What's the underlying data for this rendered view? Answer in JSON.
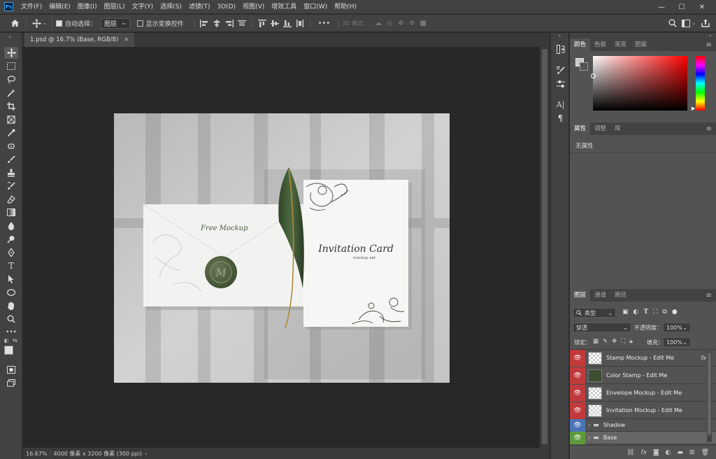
{
  "menubar": {
    "logo": "Ps",
    "items": [
      "文件(F)",
      "编辑(E)",
      "图像(I)",
      "图层(L)",
      "文字(Y)",
      "选择(S)",
      "滤镜(T)",
      "3D(D)",
      "视图(V)",
      "增效工具",
      "窗口(W)",
      "帮助(H)"
    ],
    "minimize": "—",
    "maximize": "☐",
    "close": "✕"
  },
  "options": {
    "auto_select_label": "自动选择：",
    "auto_select_value": "图层",
    "show_transform_label": "显示变换控件",
    "mode_3d_label": "3D 模式：",
    "more": "•••"
  },
  "document": {
    "tab_title": "1.psd @ 16.7% (Base, RGB/8)",
    "tab_close": "×"
  },
  "mockup": {
    "envelope_text": "Free Mockup",
    "seal_letter": "M",
    "card_title": "Invitation Card",
    "card_subtitle": "mockup  set"
  },
  "status": {
    "zoom": "16.67%",
    "dimensions": "4000 像素 x 3200 像素 (300 ppi)",
    "arrow": "›"
  },
  "color_panel": {
    "tabs": [
      "颜色",
      "色板",
      "渐变",
      "图案"
    ]
  },
  "properties_panel": {
    "tabs": [
      "属性",
      "调整",
      "库"
    ],
    "content": "无属性"
  },
  "layers_panel": {
    "tabs": [
      "图层",
      "通道",
      "路径"
    ],
    "filter_kind": "类型",
    "blend_mode": "穿透",
    "opacity_label": "不透明度：",
    "opacity_value": "100%",
    "lock_label": "锁定：",
    "fill_label": "填充：",
    "fill_value": "100%",
    "fx": "fx",
    "layers": [
      {
        "name": "Stamp Mockup - Edit Me",
        "eye_color": "#c0393b",
        "thumb": "checker"
      },
      {
        "name": "Color Stamp - Edit Me",
        "eye_color": "#c0393b",
        "thumb": "green"
      },
      {
        "name": "Envelope Mockup - Edit Me",
        "eye_color": "#c0393b",
        "thumb": "checker"
      },
      {
        "name": "Invitation Mockup - Edit Me",
        "eye_color": "#c0393b",
        "thumb": "checker"
      }
    ],
    "groups": [
      {
        "name": "Shadow",
        "eye_color": "#4a74b5"
      },
      {
        "name": "Base",
        "eye_color": "#5e9a3a"
      }
    ]
  },
  "colors": {
    "ui_bg": "#424242",
    "panel_bg": "#535353",
    "canvas_bg": "#282828",
    "seal_green": "#4a5a3c",
    "leaf_green": "#3d5634",
    "ink": "#3f4a3a"
  }
}
